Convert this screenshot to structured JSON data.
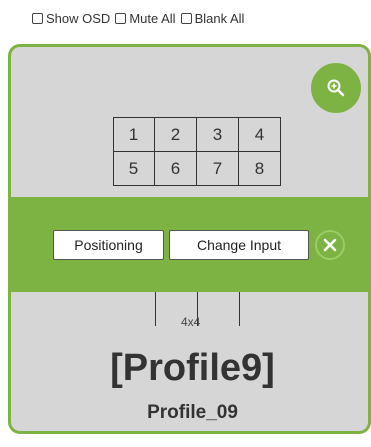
{
  "options": {
    "show_osd": "Show OSD",
    "mute_all": "Mute All",
    "blank_all": "Blank All"
  },
  "card": {
    "matrix_cells": [
      "1",
      "2",
      "3",
      "4",
      "5",
      "6",
      "7",
      "8"
    ],
    "size_label": "4x4",
    "profile_title": "[Profile9]",
    "profile_name": "Profile_09",
    "positioning_label": "Positioning",
    "change_input_label": "Change Input",
    "zoom_icon": "zoom-in-icon",
    "close_icon": "close-icon"
  },
  "colors": {
    "accent": "#7cb342",
    "card_bg": "#d6d6d6"
  }
}
